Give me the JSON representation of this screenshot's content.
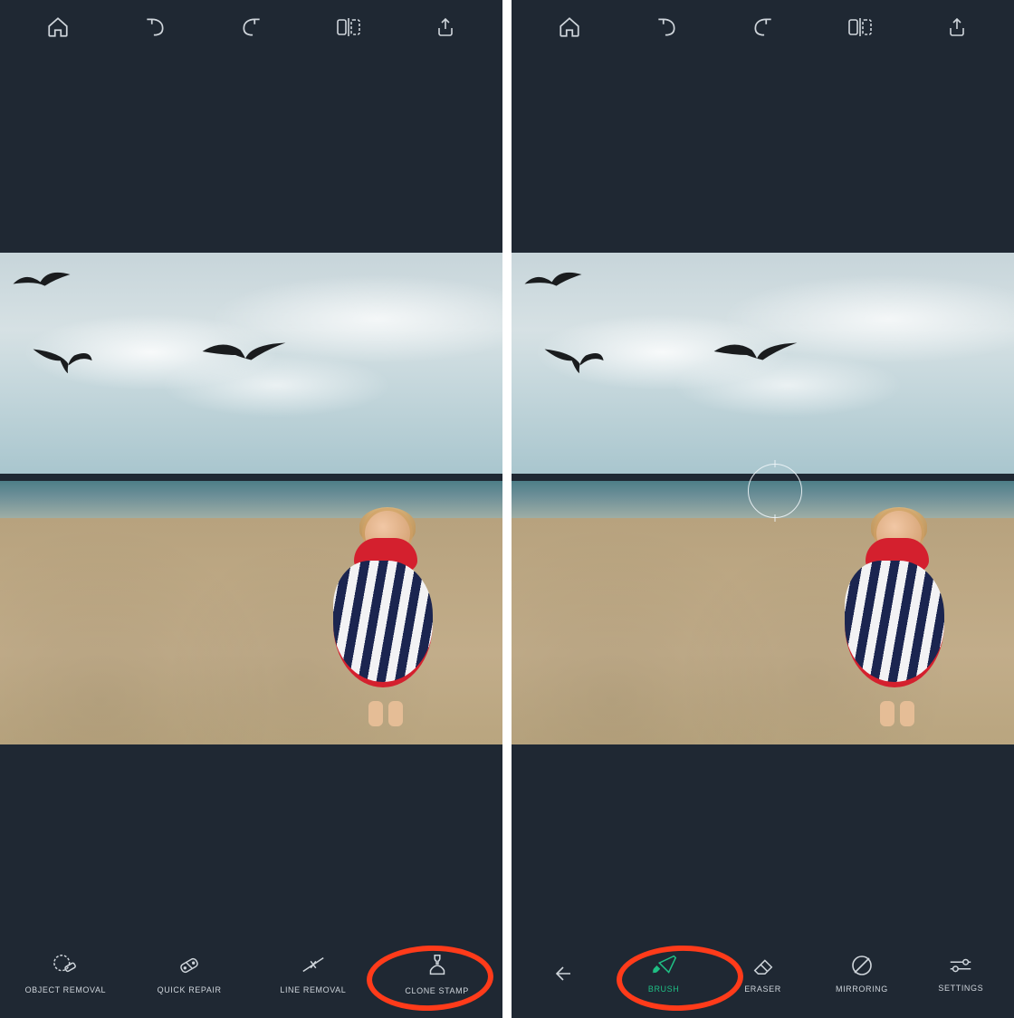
{
  "colors": {
    "bg": "#1f2833",
    "icon": "#cfd5db",
    "accent": "#1fbf84",
    "highlight": "#ff3b1a"
  },
  "topbar": {
    "items": [
      "home-icon",
      "undo-icon",
      "redo-icon",
      "compare-icon",
      "share-icon"
    ]
  },
  "leftPane": {
    "tools": [
      {
        "id": "object-removal",
        "label": "OBJECT REMOVAL",
        "active": false
      },
      {
        "id": "quick-repair",
        "label": "QUICK REPAIR",
        "active": false
      },
      {
        "id": "line-removal",
        "label": "LINE REMOVAL",
        "active": false
      },
      {
        "id": "clone-stamp",
        "label": "CLONE STAMP",
        "active": false,
        "highlighted": true
      }
    ]
  },
  "rightPane": {
    "tools": [
      {
        "id": "back",
        "label": "",
        "active": false,
        "iconOnly": true
      },
      {
        "id": "brush",
        "label": "BRUSH",
        "active": true,
        "highlighted": true
      },
      {
        "id": "eraser",
        "label": "ERASER",
        "active": false
      },
      {
        "id": "mirroring",
        "label": "MIRRORING",
        "active": false
      },
      {
        "id": "settings",
        "label": "SETTINGS",
        "active": false
      }
    ]
  }
}
